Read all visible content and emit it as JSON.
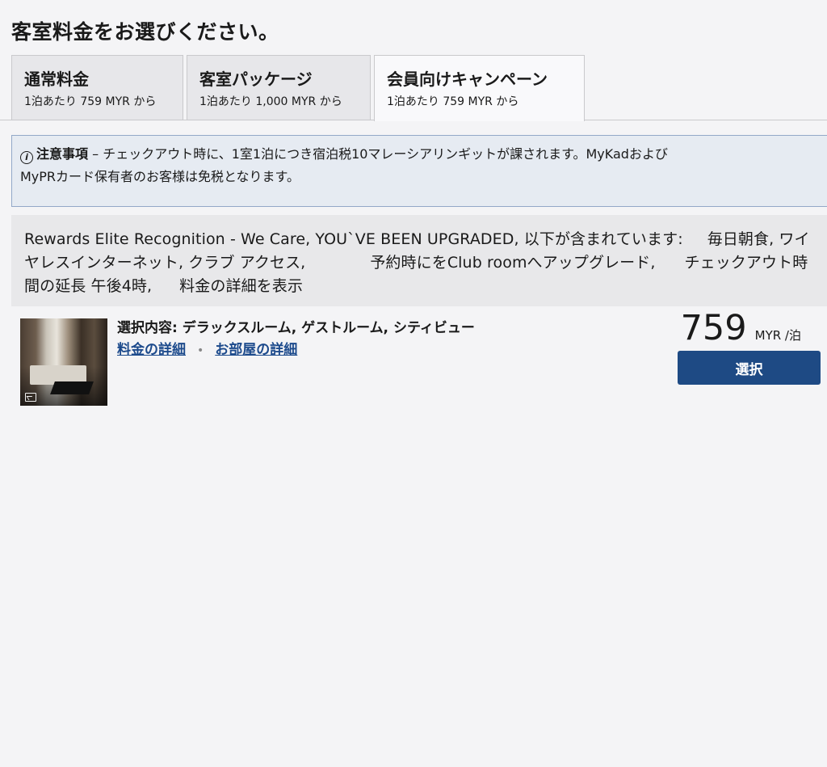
{
  "page": {
    "title": "客室料金をお選びください。"
  },
  "tabs": [
    {
      "name": "通常料金",
      "price_label": "1泊あたり 759 MYR から"
    },
    {
      "name": "客室パッケージ",
      "price_label": "1泊あたり 1,000 MYR から"
    },
    {
      "name": "会員向けキャンペーン",
      "price_label": "1泊あたり 759 MYR から",
      "active": true
    }
  ],
  "notice": {
    "label": "注意事項",
    "dash": " – ",
    "text_line1": "チェックアウト時に、1室1泊につき宿泊税10マレーシアリンギットが課されます。MyKadおよび",
    "text_line2": "MyPRカード保有者のお客様は免税となります。"
  },
  "rate": {
    "part1": "Rewards Elite Recognition - We Care, YOU`VE BEEN UPGRADED, 以下が含まれています:",
    "part2": "毎日朝食, ワイヤレスインターネット, クラブ アクセス,",
    "part3": "予約時にをClub roomへアップグレード,",
    "part4": "チェックアウト時間の延長 午後4時,",
    "detail_link": "料金の詳細を表示"
  },
  "room": {
    "selection": "選択内容: デラックスルーム, ゲストルーム, シティビュー",
    "rate_details_link": "料金の詳細",
    "separator": "•",
    "room_details_link": "お部屋の詳細",
    "price": "759",
    "price_unit": "MYR /泊",
    "select_label": "選択"
  },
  "colors": {
    "accent": "#1e4a84",
    "link": "#1c4a8c",
    "notice_bg": "#e6ebf2",
    "notice_border": "#93a8c8"
  }
}
